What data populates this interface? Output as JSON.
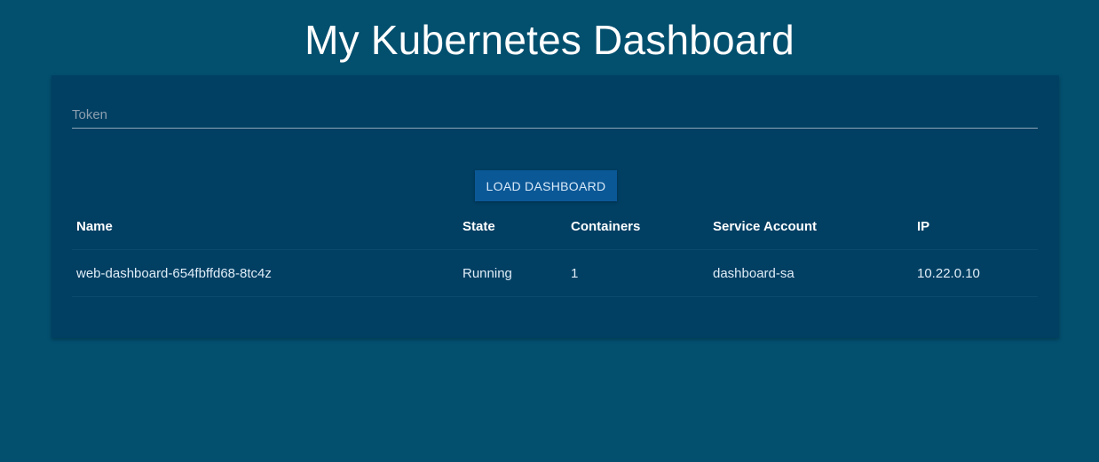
{
  "page": {
    "title": "My Kubernetes Dashboard"
  },
  "token": {
    "placeholder": "Token",
    "value": ""
  },
  "load_button": {
    "label": "LOAD DASHBOARD"
  },
  "table": {
    "headers": [
      "Name",
      "State",
      "Containers",
      "Service Account",
      "IP"
    ],
    "rows": [
      [
        "web-dashboard-654fbffd68-8tc4z",
        "Running",
        "1",
        "dashboard-sa",
        "10.22.0.10"
      ]
    ]
  },
  "colors": {
    "background": "#034f6e",
    "card": "#013f63",
    "button": "#0b5897"
  }
}
